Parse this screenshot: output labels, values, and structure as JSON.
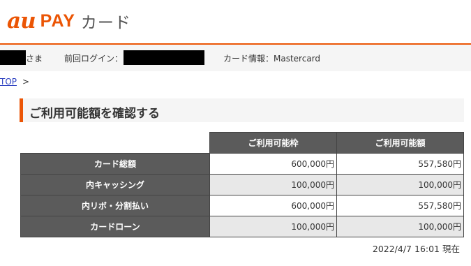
{
  "header": {
    "logo_au": "au",
    "logo_pay": "PAY",
    "logo_card": "カード",
    "accent_color": "#eb5505"
  },
  "userbar": {
    "user_suffix": "さま",
    "last_login_label": "前回ログイン：",
    "card_info": "カード情報：Mastercard"
  },
  "breadcrumb": {
    "top_link": "TOP",
    "separator": ">"
  },
  "section": {
    "title": "ご利用可能額を確認する"
  },
  "limits_table": {
    "columns": [
      "ご利用可能枠",
      "ご利用可能額"
    ],
    "rows": [
      {
        "label": "カード総額",
        "limit": "600,000円",
        "available": "557,580円"
      },
      {
        "label": "内キャッシング",
        "limit": "100,000円",
        "available": "100,000円"
      },
      {
        "label": "内リボ・分割払い",
        "limit": "600,000円",
        "available": "557,580円"
      },
      {
        "label": "カードローン",
        "limit": "100,000円",
        "available": "100,000円"
      }
    ]
  },
  "as_of": "2022/4/7 16:01 現在"
}
